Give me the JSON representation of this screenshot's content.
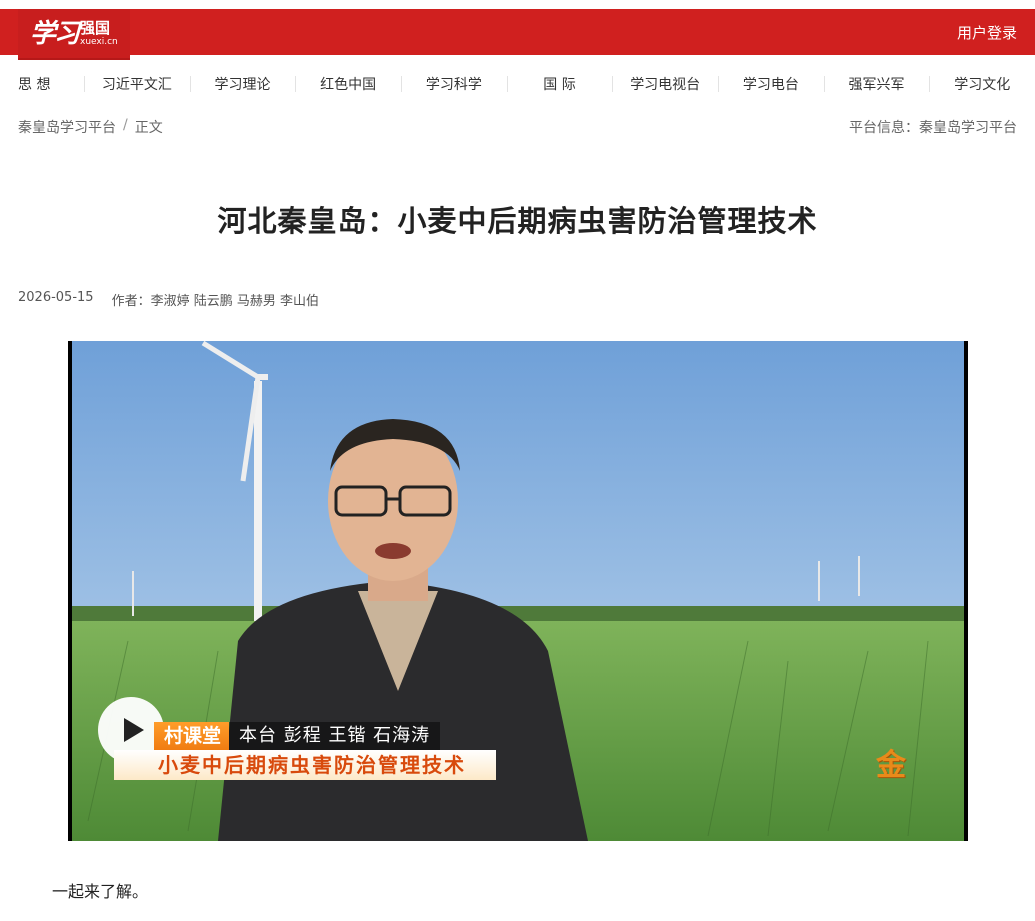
{
  "header": {
    "logo_script": "学习",
    "logo_cn": "强国",
    "logo_en": "xuexi.cn",
    "login": "用户登录",
    "brand_color": "#d0201f"
  },
  "nav": {
    "items": [
      {
        "label": "思 想"
      },
      {
        "label": "习近平文汇"
      },
      {
        "label": "学习理论"
      },
      {
        "label": "红色中国"
      },
      {
        "label": "学习科学"
      },
      {
        "label": "国 际"
      },
      {
        "label": "学习电视台"
      },
      {
        "label": "学习电台"
      },
      {
        "label": "强军兴军"
      },
      {
        "label": "学习文化"
      }
    ]
  },
  "breadcrumb": {
    "home": "秦皇岛学习平台",
    "sep": "/",
    "current": "正文"
  },
  "platform_info": {
    "label": "平台信息：",
    "value": "秦皇岛学习平台"
  },
  "article": {
    "title": "河北秦皇岛：小麦中后期病虫害防治管理技术",
    "date": "2026-05-15",
    "author": "作者：李淑婷 陆云鹏 马赫男 李山伯",
    "body": "一起来了解。"
  },
  "video": {
    "play_icon": "play-icon",
    "caption_tag": "村课堂",
    "caption_names": "本台 彭程 王锴 石海涛",
    "caption_title": "小麦中后期病虫害防治管理技术",
    "corner_logo": "金"
  }
}
